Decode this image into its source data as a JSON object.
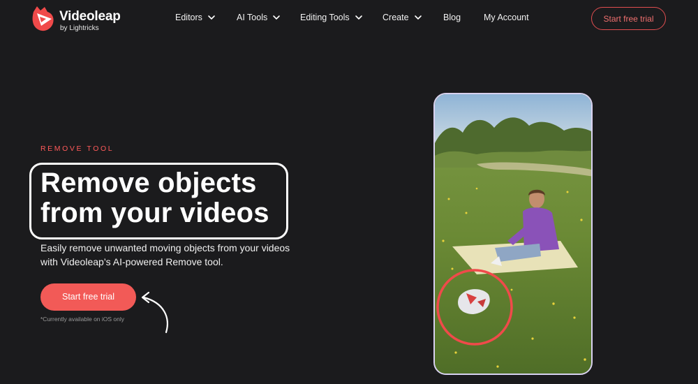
{
  "header": {
    "brand_name": "Videoleap",
    "brand_sub": "by Lightricks",
    "nav": [
      {
        "label": "Editors",
        "has_dropdown": true
      },
      {
        "label": "AI Tools",
        "has_dropdown": true
      },
      {
        "label": "Editing Tools",
        "has_dropdown": true
      },
      {
        "label": "Create",
        "has_dropdown": true
      },
      {
        "label": "Blog",
        "has_dropdown": false
      },
      {
        "label": "My Account",
        "has_dropdown": false
      }
    ],
    "cta_label": "Start free trial"
  },
  "hero": {
    "eyebrow": "REMOVE TOOL",
    "title_line1": "Remove objects",
    "title_line2": "from your videos",
    "subtitle": "Easily remove unwanted moving objects from your videos with Videoleap’s AI-powered Remove tool.",
    "cta_label": "Start free trial",
    "note": "*Currently available on iOS only"
  },
  "preview": {
    "icon": "video-preview-remove-tool"
  },
  "colors": {
    "background": "#1b1b1d",
    "accent": "#f25a57",
    "accent_text": "#ff5a5a",
    "phone_border": "#d9d2f0"
  }
}
